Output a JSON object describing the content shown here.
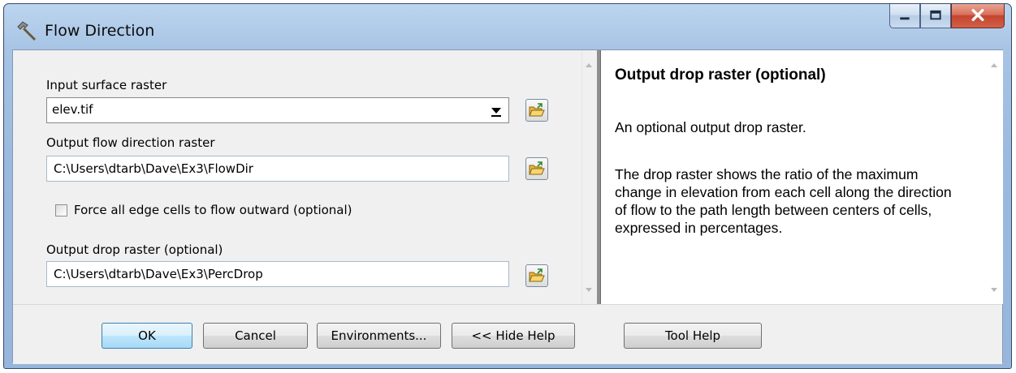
{
  "window": {
    "title": "Flow Direction",
    "colors": {
      "accent": "#3c7fb1",
      "close_red": "#c4442d",
      "frame": "#9ab9de"
    }
  },
  "params": {
    "input_surface_label": "Input surface raster",
    "input_surface_value": "elev.tif",
    "output_flow_label": "Output flow direction raster",
    "output_flow_value": "C:\\Users\\dtarb\\Dave\\Ex3\\FlowDir",
    "force_edge_label": "Force all edge cells to flow outward (optional)",
    "force_edge_checked": false,
    "output_drop_label": "Output drop raster (optional)",
    "output_drop_value": "C:\\Users\\dtarb\\Dave\\Ex3\\PercDrop"
  },
  "help": {
    "title": "Output drop raster (optional)",
    "p1": "An optional output drop raster.",
    "p2": "The drop raster shows the ratio of the maximum change in elevation from each cell along the direction of flow to the path length between centers of cells, expressed in percentages."
  },
  "buttons": {
    "ok": "OK",
    "cancel": "Cancel",
    "environments": "Environments...",
    "hide_help": "<< Hide Help",
    "tool_help": "Tool Help"
  },
  "icons": {
    "app": "hammer-icon",
    "browse": "open-folder-icon",
    "minimize": "minimize-icon",
    "maximize": "maximize-icon",
    "close": "close-icon"
  }
}
